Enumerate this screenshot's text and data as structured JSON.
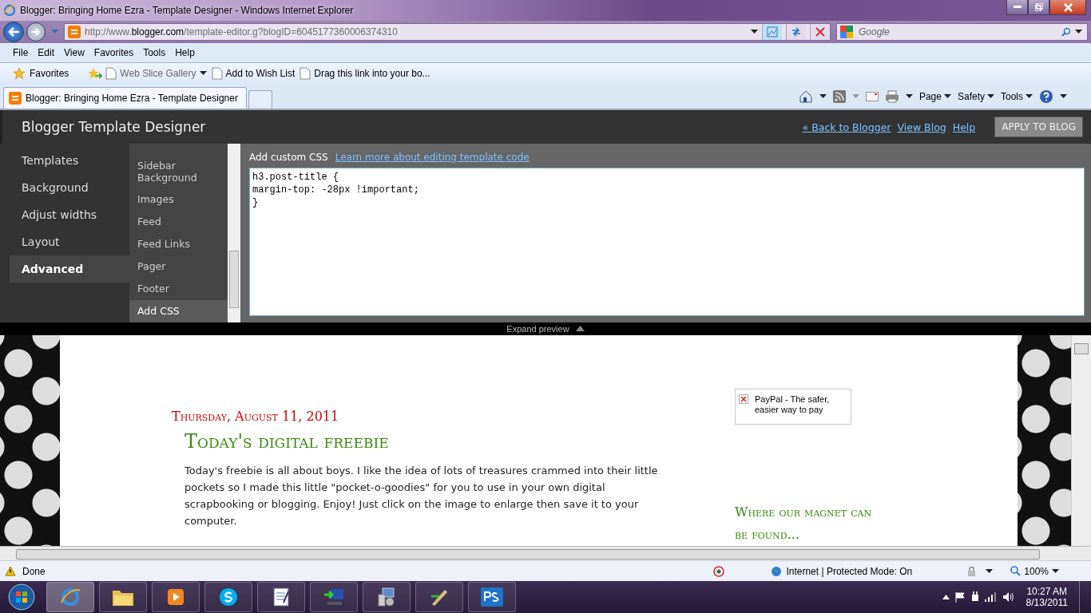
{
  "window": {
    "title": "Blogger: Bringing Home Ezra - Template Designer - Windows Internet Explorer"
  },
  "address_bar": {
    "url_prefix": "http://www.",
    "url_domain": "blogger.com",
    "url_rest": "/template-editor.g?blogID=6045177360006374310",
    "search_placeholder": "Google"
  },
  "menu": [
    "File",
    "Edit",
    "View",
    "Favorites",
    "Tools",
    "Help"
  ],
  "favorites_bar": [
    {
      "label": "Favorites",
      "kind": "favorites"
    },
    {
      "label": "Web Slice Gallery",
      "kind": "dropdown"
    },
    {
      "label": "Add to Wish List",
      "kind": "link"
    },
    {
      "label": "Drag this link into your bo...",
      "kind": "link"
    }
  ],
  "tabs": [
    {
      "label": "Blogger: Bringing Home Ezra - Template Designer",
      "selected": true
    }
  ],
  "command_bar": [
    "Page",
    "Safety",
    "Tools"
  ],
  "designer": {
    "title": "Blogger Template Designer",
    "links": [
      "« Back to Blogger",
      "View Blog",
      "Help"
    ],
    "apply_button": {
      "label": "APPLY TO BLOG",
      "disabled": true
    },
    "nav": [
      {
        "label": "Templates",
        "selected": false
      },
      {
        "label": "Background",
        "selected": false
      },
      {
        "label": "Adjust widths",
        "selected": false
      },
      {
        "label": "Layout",
        "selected": false
      },
      {
        "label": "Advanced",
        "selected": true
      }
    ],
    "subnav": [
      {
        "label": "Sidebar Background",
        "selected": false
      },
      {
        "label": "Images",
        "selected": false
      },
      {
        "label": "Feed",
        "selected": false
      },
      {
        "label": "Feed Links",
        "selected": false
      },
      {
        "label": "Pager",
        "selected": false
      },
      {
        "label": "Footer",
        "selected": false
      },
      {
        "label": "Add CSS",
        "selected": true
      }
    ],
    "css_label": "Add custom CSS",
    "css_link": "Learn more about editing template code",
    "css_code": "h3.post-title {\nmargin-top: -28px !important;\n}"
  },
  "expand_preview": "Expand preview",
  "preview": {
    "date": "Thursday, August 11, 2011",
    "post_title": "Today's digital freebie",
    "body": "Today's freebie is all about boys. I like the idea of lots of treasures crammed into their little pockets so I made this little \"pocket-o-goodies\" for you to use in your own digital scrapbooking or blogging. Enjoy! Just click on the image to enlarge then save it to your computer.",
    "paypal_text": "PayPal - The safer, easier way to pay",
    "sidebar_heading": "Where our magnet can be found..."
  },
  "status_bar": {
    "status": "Done",
    "zone": "Internet | Protected Mode: On",
    "zoom": "100%"
  },
  "taskbar": {
    "time": "10:27 AM",
    "date": "8/13/2011"
  }
}
